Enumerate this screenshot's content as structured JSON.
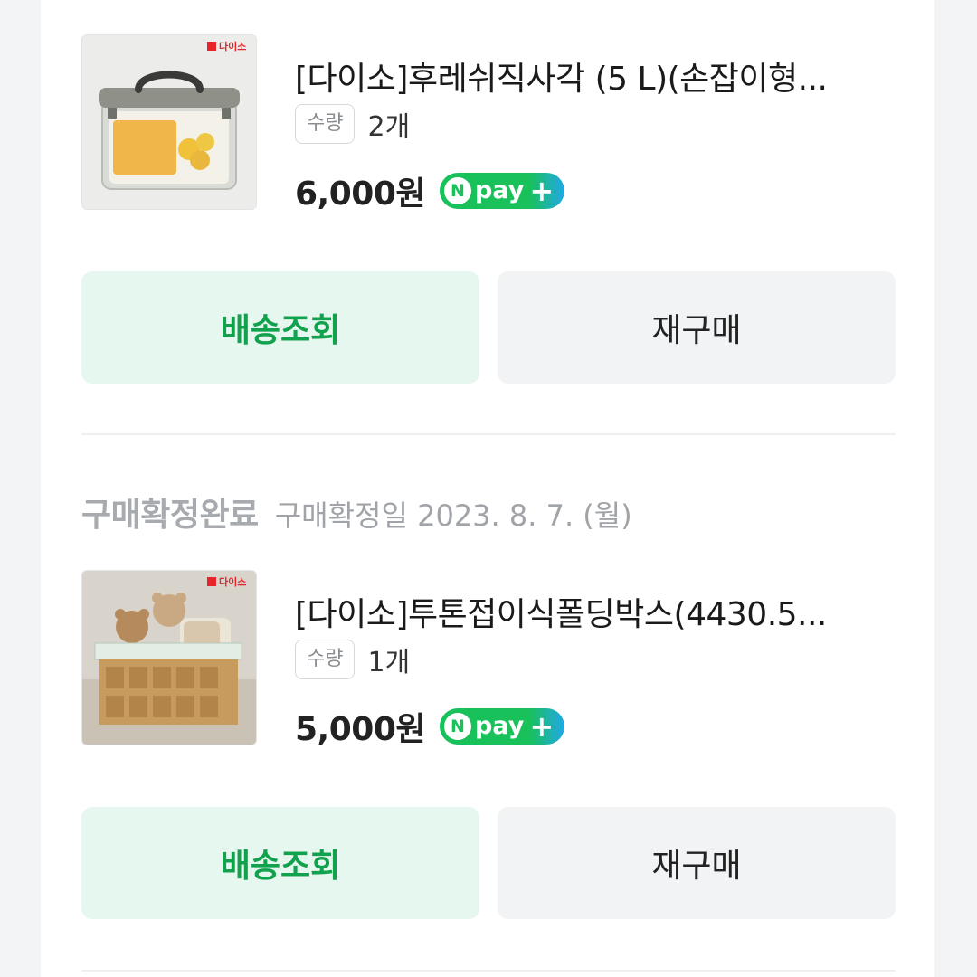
{
  "orders": [
    {
      "brand": "다이소",
      "title": "[다이소]후레쉬직사각 (5 L)(손잡이형...",
      "qty_label": "수량",
      "qty_value": "2개",
      "price": "6,000원",
      "npay": {
        "n": "N",
        "text": "pay",
        "plus": "+"
      },
      "track_label": "배송조회",
      "rebuy_label": "재구매"
    },
    {
      "status": "구매확정완료",
      "confirm_date": "구매확정일 2023. 8. 7. (월)",
      "brand": "다이소",
      "title": "[다이소]투톤접이식폴딩박스(4430.5...",
      "qty_label": "수량",
      "qty_value": "1개",
      "price": "5,000원",
      "npay": {
        "n": "N",
        "text": "pay",
        "plus": "+"
      },
      "track_label": "배송조회",
      "rebuy_label": "재구매"
    }
  ],
  "colors": {
    "accent_green": "#12a14d",
    "track_bg": "#e5f7ee",
    "rebuy_bg": "#f1f3f5",
    "npay_green": "#19c15b",
    "npay_blue": "#21a8e8"
  }
}
